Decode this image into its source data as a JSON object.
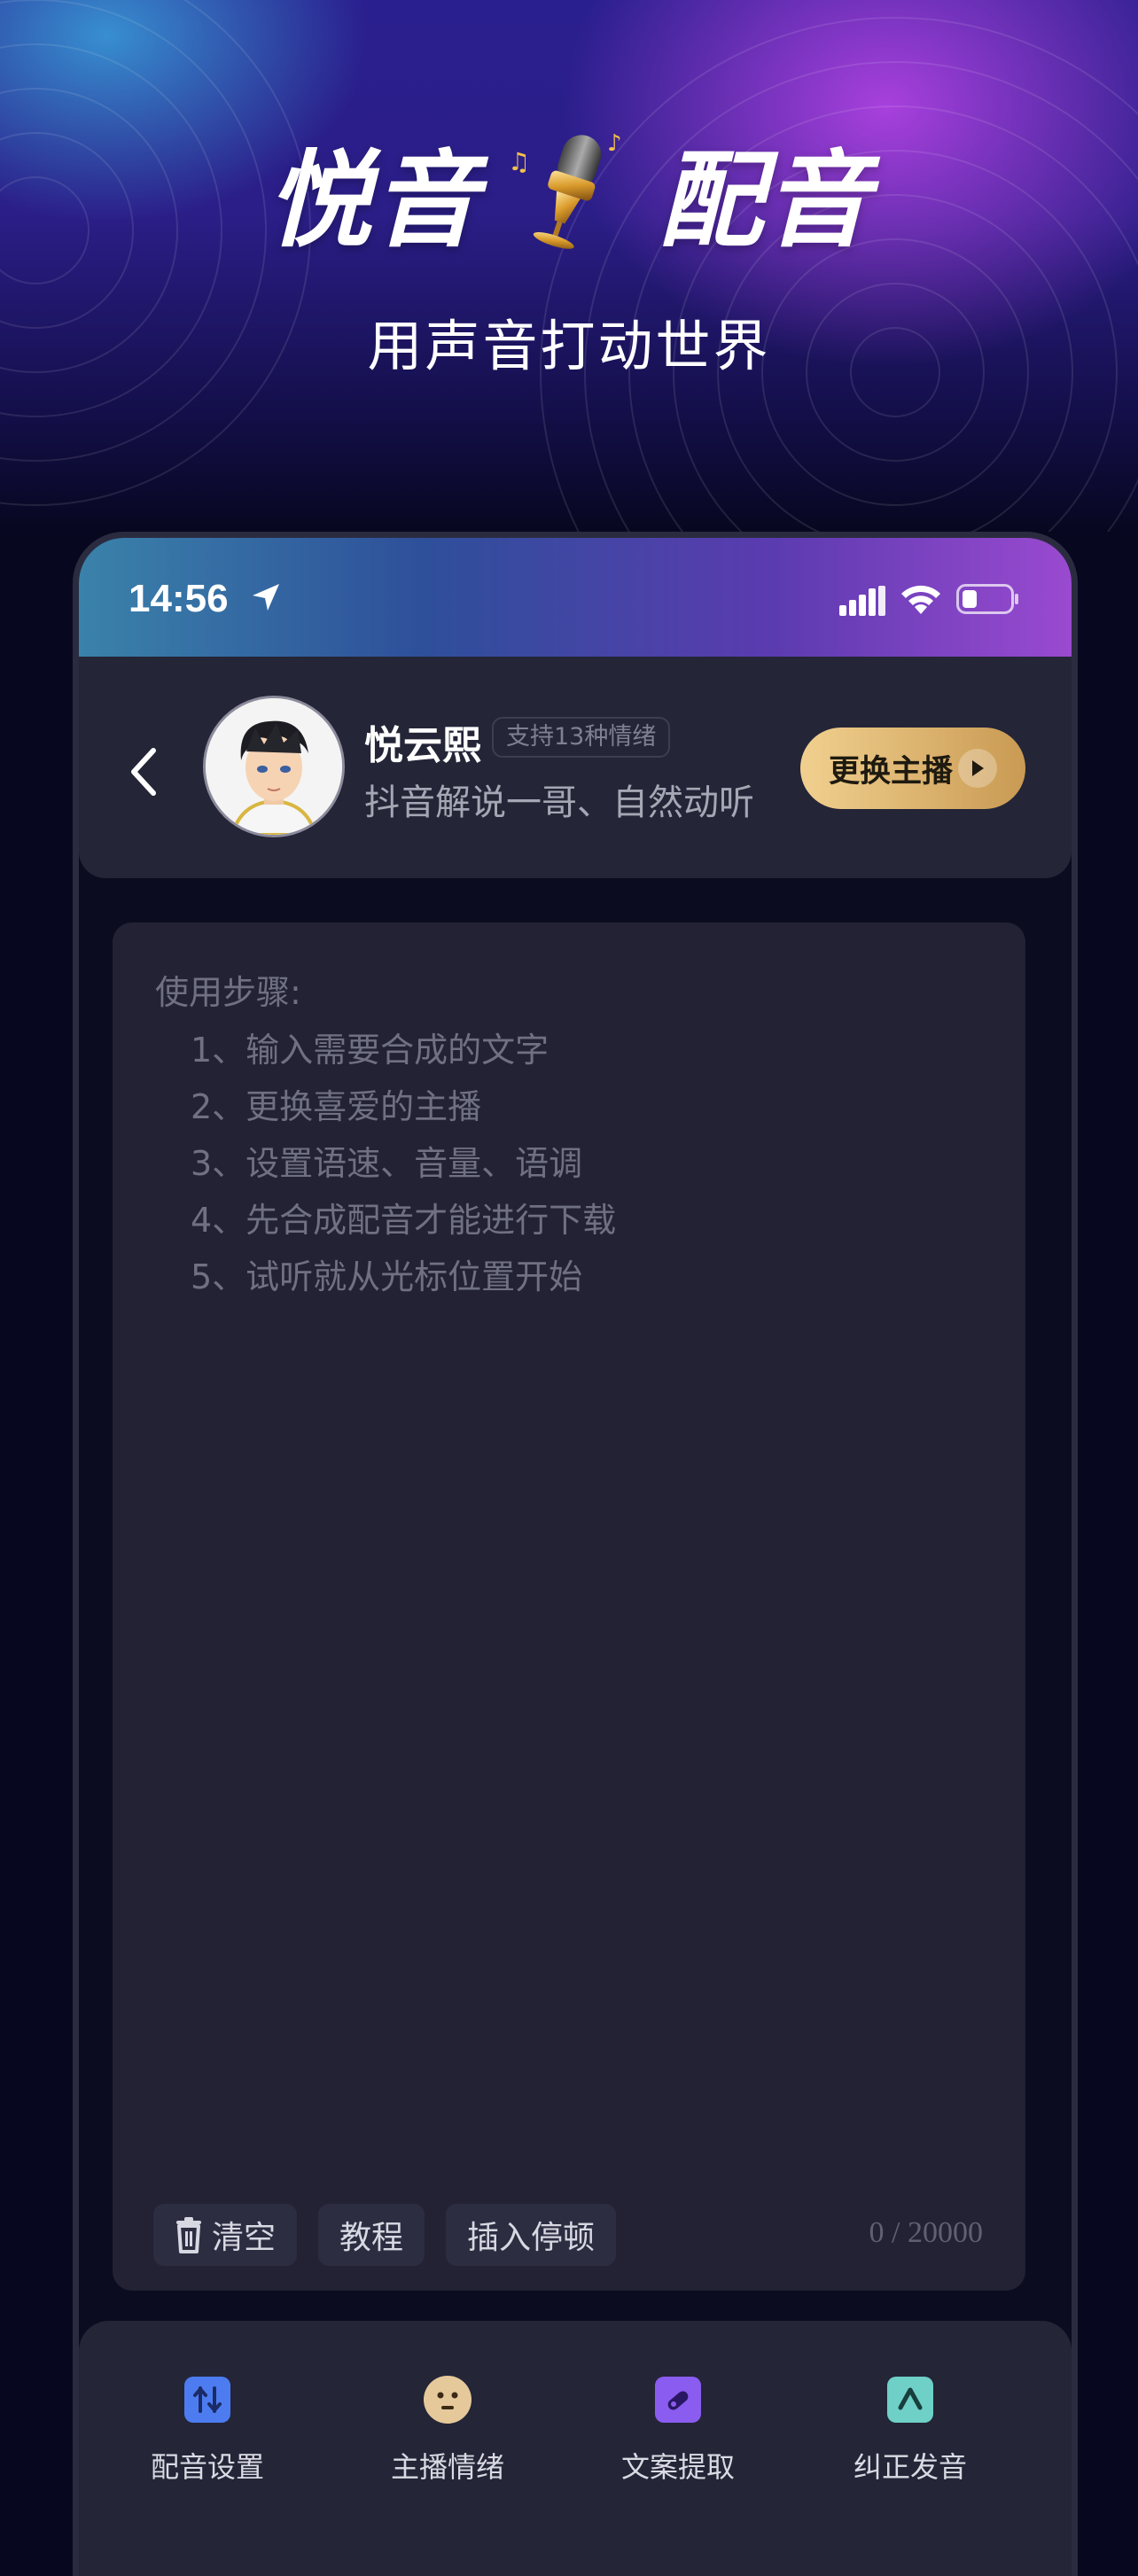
{
  "hero": {
    "title_left": "悦音",
    "title_right": "配音",
    "slogan": "用声音打动世界"
  },
  "status_bar": {
    "time": "14:56"
  },
  "host": {
    "name": "悦云熙",
    "emotion_badge": "支持13种情绪",
    "description": "抖音解说一哥、自然动听",
    "change_button": "更换主播"
  },
  "editor": {
    "steps_title": "使用步骤:",
    "steps": [
      "1、输入需要合成的文字",
      "2、更换喜爱的主播",
      "3、设置语速、音量、语调",
      "4、先合成配音才能进行下载",
      "5、试听就从光标位置开始"
    ],
    "clear_button": "清空",
    "tutorial_button": "教程",
    "insert_pause_button": "插入停顿",
    "char_count": "0 / 20000"
  },
  "features": [
    {
      "label": "配音设置",
      "icon": "sliders-icon",
      "color": "#4d7cf0"
    },
    {
      "label": "主播情绪",
      "icon": "emotion-face-icon",
      "color": "#e6c99a"
    },
    {
      "label": "文案提取",
      "icon": "extract-icon",
      "color": "#8a5cf0"
    },
    {
      "label": "纠正发音",
      "icon": "pronunciation-icon",
      "color": "#6fd0c8"
    }
  ]
}
